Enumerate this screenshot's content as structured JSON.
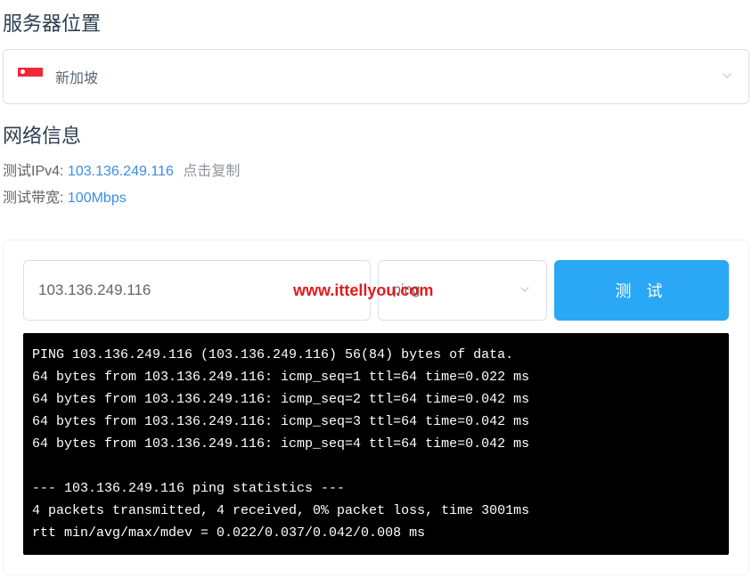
{
  "server_location": {
    "title": "服务器位置",
    "selected": "新加坡"
  },
  "network_info": {
    "title": "网络信息",
    "ipv4_label": "测试IPv4:",
    "ipv4_value": "103.136.249.116",
    "copy_hint": "点击复制",
    "bandwidth_label": "测试带宽:",
    "bandwidth_value": "100Mbps"
  },
  "test_panel": {
    "ip_input_value": "103.136.249.116",
    "method_selected": "ping",
    "button_label": "测 试",
    "terminal_output": "PING 103.136.249.116 (103.136.249.116) 56(84) bytes of data.\n64 bytes from 103.136.249.116: icmp_seq=1 ttl=64 time=0.022 ms\n64 bytes from 103.136.249.116: icmp_seq=2 ttl=64 time=0.042 ms\n64 bytes from 103.136.249.116: icmp_seq=3 ttl=64 time=0.042 ms\n64 bytes from 103.136.249.116: icmp_seq=4 ttl=64 time=0.042 ms\n\n--- 103.136.249.116 ping statistics ---\n4 packets transmitted, 4 received, 0% packet loss, time 3001ms\nrtt min/avg/max/mdev = 0.022/0.037/0.042/0.008 ms"
  },
  "watermark": "www.ittellyou.com"
}
